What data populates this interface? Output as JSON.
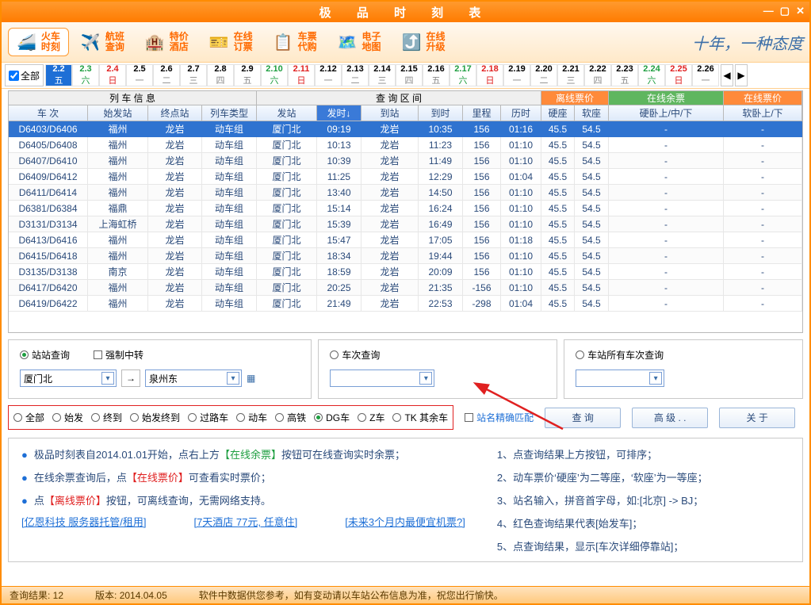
{
  "window": {
    "title": "极 品 时 刻 表"
  },
  "toolbar": {
    "train": {
      "l1": "火车",
      "l2": "时刻"
    },
    "flight": {
      "l1": "航班",
      "l2": "查询"
    },
    "hotel": {
      "l1": "特价",
      "l2": "酒店"
    },
    "order": {
      "l1": "在线",
      "l2": "订票"
    },
    "buy": {
      "l1": "车票",
      "l2": "代购"
    },
    "map": {
      "l1": "电子",
      "l2": "地图"
    },
    "upgrade": {
      "l1": "在线",
      "l2": "升级"
    },
    "slogan": "十年，一种态度"
  },
  "datebar": {
    "all": "全部",
    "cells": [
      {
        "d": "2.2",
        "w": "五",
        "cls": "sel"
      },
      {
        "d": "2.3",
        "w": "六",
        "cls": "green"
      },
      {
        "d": "2.4",
        "w": "日",
        "cls": "red"
      },
      {
        "d": "2.5",
        "w": "一",
        "cls": ""
      },
      {
        "d": "2.6",
        "w": "二",
        "cls": ""
      },
      {
        "d": "2.7",
        "w": "三",
        "cls": ""
      },
      {
        "d": "2.8",
        "w": "四",
        "cls": ""
      },
      {
        "d": "2.9",
        "w": "五",
        "cls": ""
      },
      {
        "d": "2.10",
        "w": "六",
        "cls": "green"
      },
      {
        "d": "2.11",
        "w": "日",
        "cls": "red"
      },
      {
        "d": "2.12",
        "w": "一",
        "cls": ""
      },
      {
        "d": "2.13",
        "w": "二",
        "cls": ""
      },
      {
        "d": "2.14",
        "w": "三",
        "cls": ""
      },
      {
        "d": "2.15",
        "w": "四",
        "cls": ""
      },
      {
        "d": "2.16",
        "w": "五",
        "cls": ""
      },
      {
        "d": "2.17",
        "w": "六",
        "cls": "green"
      },
      {
        "d": "2.18",
        "w": "日",
        "cls": "red"
      },
      {
        "d": "2.19",
        "w": "一",
        "cls": ""
      },
      {
        "d": "2.20",
        "w": "二",
        "cls": ""
      },
      {
        "d": "2.21",
        "w": "三",
        "cls": ""
      },
      {
        "d": "2.22",
        "w": "四",
        "cls": ""
      },
      {
        "d": "2.23",
        "w": "五",
        "cls": ""
      },
      {
        "d": "2.24",
        "w": "六",
        "cls": "green"
      },
      {
        "d": "2.25",
        "w": "日",
        "cls": "red"
      },
      {
        "d": "2.26",
        "w": "一",
        "cls": ""
      }
    ]
  },
  "groups": {
    "info": "列 车 信 息",
    "query": "查 询 区 间",
    "off": "离线票价",
    "rem": "在线余票",
    "onl": "在线票价"
  },
  "cols": [
    "车 次",
    "始发站",
    "终点站",
    "列车类型",
    "发站",
    "发时↓",
    "到站",
    "到时",
    "里程",
    "历时",
    "硬座",
    "软座",
    "硬卧上/中/下",
    "软卧上/下"
  ],
  "rows": [
    [
      "D6403/D6406",
      "福州",
      "龙岩",
      "动车组",
      "厦门北",
      "09:19",
      "龙岩",
      "10:35",
      "156",
      "01:16",
      "45.5",
      "54.5",
      "-",
      "-"
    ],
    [
      "D6405/D6408",
      "福州",
      "龙岩",
      "动车组",
      "厦门北",
      "10:13",
      "龙岩",
      "11:23",
      "156",
      "01:10",
      "45.5",
      "54.5",
      "-",
      "-"
    ],
    [
      "D6407/D6410",
      "福州",
      "龙岩",
      "动车组",
      "厦门北",
      "10:39",
      "龙岩",
      "11:49",
      "156",
      "01:10",
      "45.5",
      "54.5",
      "-",
      "-"
    ],
    [
      "D6409/D6412",
      "福州",
      "龙岩",
      "动车组",
      "厦门北",
      "11:25",
      "龙岩",
      "12:29",
      "156",
      "01:04",
      "45.5",
      "54.5",
      "-",
      "-"
    ],
    [
      "D6411/D6414",
      "福州",
      "龙岩",
      "动车组",
      "厦门北",
      "13:40",
      "龙岩",
      "14:50",
      "156",
      "01:10",
      "45.5",
      "54.5",
      "-",
      "-"
    ],
    [
      "D6381/D6384",
      "福鼎",
      "龙岩",
      "动车组",
      "厦门北",
      "15:14",
      "龙岩",
      "16:24",
      "156",
      "01:10",
      "45.5",
      "54.5",
      "-",
      "-"
    ],
    [
      "D3131/D3134",
      "上海虹桥",
      "龙岩",
      "动车组",
      "厦门北",
      "15:39",
      "龙岩",
      "16:49",
      "156",
      "01:10",
      "45.5",
      "54.5",
      "-",
      "-"
    ],
    [
      "D6413/D6416",
      "福州",
      "龙岩",
      "动车组",
      "厦门北",
      "15:47",
      "龙岩",
      "17:05",
      "156",
      "01:18",
      "45.5",
      "54.5",
      "-",
      "-"
    ],
    [
      "D6415/D6418",
      "福州",
      "龙岩",
      "动车组",
      "厦门北",
      "18:34",
      "龙岩",
      "19:44",
      "156",
      "01:10",
      "45.5",
      "54.5",
      "-",
      "-"
    ],
    [
      "D3135/D3138",
      "南京",
      "龙岩",
      "动车组",
      "厦门北",
      "18:59",
      "龙岩",
      "20:09",
      "156",
      "01:10",
      "45.5",
      "54.5",
      "-",
      "-"
    ],
    [
      "D6417/D6420",
      "福州",
      "龙岩",
      "动车组",
      "厦门北",
      "20:25",
      "龙岩",
      "21:35",
      "-156",
      "01:10",
      "45.5",
      "54.5",
      "-",
      "-"
    ],
    [
      "D6419/D6422",
      "福州",
      "龙岩",
      "动车组",
      "厦门北",
      "21:49",
      "龙岩",
      "22:53",
      "-298",
      "01:04",
      "45.5",
      "54.5",
      "-",
      "-"
    ]
  ],
  "query": {
    "station_radio": "站站查询",
    "force_cb": "强制中转",
    "train_radio": "车次查询",
    "all_radio": "车站所有车次查询",
    "from": "厦门北",
    "to": "泉州东"
  },
  "filters": {
    "items": [
      "全部",
      "始发",
      "终到",
      "始发终到",
      "过路车",
      "动车",
      "高铁",
      "DG车",
      "Z车",
      "TK 其余车"
    ],
    "selected": "DG车",
    "exact": "站名精确匹配",
    "query_btn": "查 询",
    "adv_btn": "高 级 . .",
    "about_btn": "关 于"
  },
  "tips": {
    "left": [
      {
        "pre": "极品时刻表自2014.01.01开始，点右上方",
        "g": "【在线余票】",
        "post": "按钮可在线查询实时余票；"
      },
      {
        "pre": "在线余票查询后，点",
        "r": "【在线票价】",
        "post": "可查看实时票价；"
      },
      {
        "pre": "点",
        "r": "【离线票价】",
        "post": "按钮，可离线查询，无需网络支持。"
      }
    ],
    "links": [
      "[亿恩科技 服务器托管/租用]",
      "[7天酒店 77元, 任意住]",
      "[未来3个月内最便宜机票?]"
    ],
    "right": [
      "1、点查询结果上方按钮，可排序；",
      "2、动车票价‘硬座’为二等座，‘软座’为一等座；",
      "3、站名输入，拼音首字母，如:[北京] -> BJ；",
      "4、红色查询结果代表[始发车]；",
      "5、点查询结果，显示[车次详细停靠站]；"
    ]
  },
  "status": {
    "result": "查询结果: 12",
    "version": "版本: 2014.04.05",
    "note": "软件中数据供您参考，如有变动请以车站公布信息为准，祝您出行愉快。"
  }
}
